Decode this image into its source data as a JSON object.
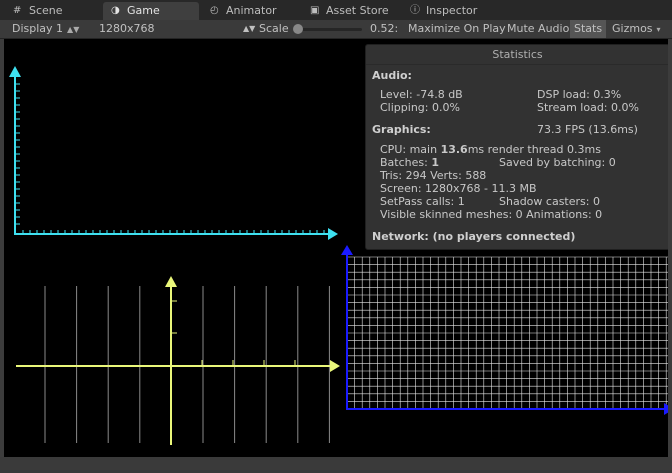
{
  "tabs": [
    {
      "label": "Scene",
      "icon": "scene-icon",
      "glyph": "#"
    },
    {
      "label": "Game",
      "icon": "game-icon",
      "glyph": "◑"
    },
    {
      "label": "Animator",
      "icon": "animator-icon",
      "glyph": "◴"
    },
    {
      "label": "Asset Store",
      "icon": "asset-store-icon",
      "glyph": "▣"
    },
    {
      "label": "Inspector",
      "icon": "inspector-icon",
      "glyph": "ⓘ"
    }
  ],
  "toolbar": {
    "display": "Display 1",
    "resolution": "1280x768",
    "scale_label": "Scale",
    "scale_value": "0.52:",
    "scale_fraction": 0.02,
    "maximize": "Maximize On Play",
    "mute": "Mute Audio",
    "stats": "Stats",
    "gizmos": "Gizmos"
  },
  "stats": {
    "title": "Statistics",
    "audio_header": "Audio:",
    "level": "Level: -74.8 dB",
    "clipping": "Clipping: 0.0%",
    "dsp": "DSP load: 0.3%",
    "stream": "Stream load: 0.0%",
    "graphics_header": "Graphics:",
    "fps": "73.3 FPS (13.6ms)",
    "cpu_prefix": "CPU: main ",
    "cpu_main": "13.6",
    "cpu_suffix": "ms  render thread 0.3ms",
    "batches_label": "Batches: ",
    "batches_value": "1",
    "saved_batching": "Saved by batching: 0",
    "tris": "Tris: 294  Verts: 588",
    "screen": "Screen: 1280x768 - 11.3 MB",
    "setpass": "SetPass calls: 1",
    "shadow": "Shadow casters: 0",
    "skinned": "Visible skinned meshes: 0  Animations: 0",
    "network": "Network: (no players connected)"
  },
  "colors": {
    "cyan": "#3ee0f0",
    "yellow": "#eaf77a",
    "blue": "#1a1aff",
    "grid": "#ffffff"
  }
}
